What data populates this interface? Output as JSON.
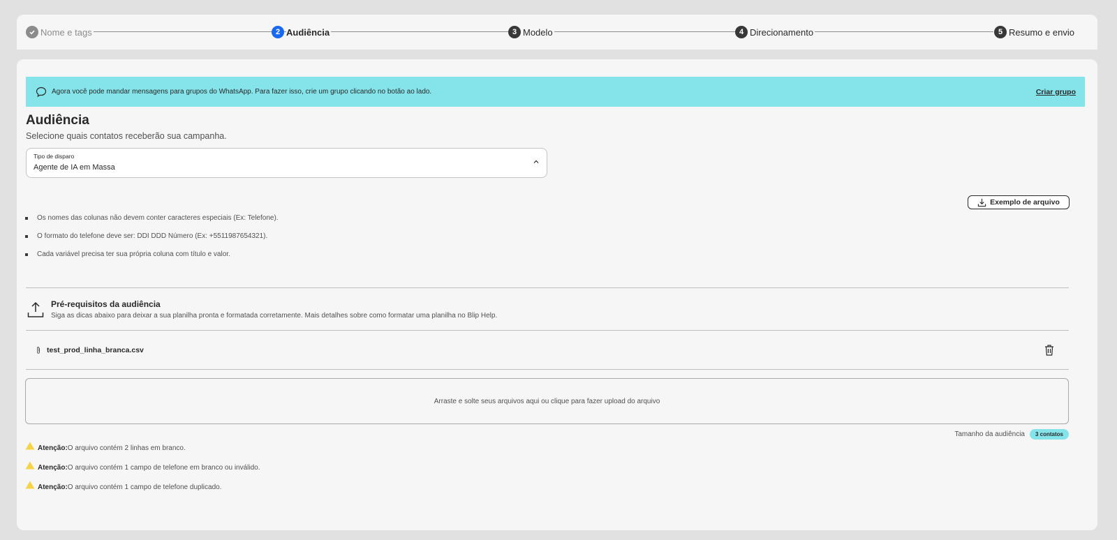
{
  "stepper": {
    "steps": [
      {
        "num": "",
        "label": "Nome e tags",
        "state": "done"
      },
      {
        "num": "2",
        "label": "Audiência",
        "state": "active"
      },
      {
        "num": "3",
        "label": "Modelo",
        "state": "todo"
      },
      {
        "num": "4",
        "label": "Direcionamento",
        "state": "todo"
      },
      {
        "num": "5",
        "label": "Resumo e envio",
        "state": "todo"
      }
    ]
  },
  "banner": {
    "message": "Agora você pode mandar mensagens para grupos do WhatsApp. Para fazer isso, crie um grupo clicando no botão ao lado.",
    "link": "Criar grupo",
    "color": "#84e4ea"
  },
  "page": {
    "title": "Audiência",
    "subtitle": "Selecione quais contatos receberão sua campanha."
  },
  "select": {
    "label": "Tipo de disparo",
    "value": "Agente de IA em Massa"
  },
  "example_button": {
    "label": "Exemplo de arquivo"
  },
  "tips": [
    "Os nomes das colunas não devem conter caracteres especiais (Ex: Telefone).",
    "O formato do telefone deve ser: DDI DDD Número (Ex: +5511987654321).",
    "Cada variável precisa ter sua própria coluna com título e valor."
  ],
  "prereq": {
    "title": "Pré-requisitos da audiência",
    "text": "Siga as dicas abaixo para deixar a sua planilha pronta e formatada corretamente. Mais detalhes sobre como formatar uma planilha no Blip Help."
  },
  "file": {
    "name": "test_prod_linha_branca.csv"
  },
  "dropzone": {
    "text": "Arraste e solte seus arquivos aqui ou clique para fazer upload do arquivo"
  },
  "audience": {
    "label": "Tamanho da audiência",
    "count": "3 contatos"
  },
  "warnings": [
    {
      "prefix": "Atenção:",
      "text": "O arquivo contém 2 linhas em branco."
    },
    {
      "prefix": "Atenção:",
      "text": "O arquivo contém 1 campo de telefone em branco ou inválido."
    },
    {
      "prefix": "Atenção:",
      "text": "O arquivo contém 1 campo de telefone duplicado."
    }
  ],
  "colors": {
    "accent": "#1968f0",
    "warning": "#f5d44a",
    "banner": "#84e4ea"
  }
}
